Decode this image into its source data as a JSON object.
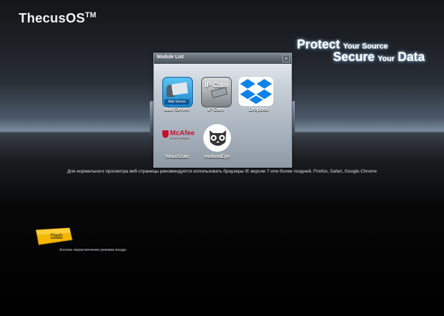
{
  "brand": {
    "name": "ThecusOS",
    "tm": "TM"
  },
  "tagline": {
    "line1_big": "Protect",
    "line1_small": "Your Source",
    "line2_big1": "Secure",
    "line2_small": "Your",
    "line2_big2": "Data"
  },
  "module_list": {
    "title": "Module List",
    "close_symbol": "×",
    "modules": [
      {
        "label": "Mail Server",
        "icon": "mail-server-icon",
        "icon_text": "Mail Server"
      },
      {
        "label": "IP Cam",
        "icon": "ip-cam-icon",
        "icon_text": "IP Cam"
      },
      {
        "label": "Dropbox",
        "icon": "dropbox-icon"
      },
      {
        "label": "VirusScan",
        "icon": "mcafee-icon",
        "icon_text": "McAfee",
        "icon_subtext": "An Intel Company"
      },
      {
        "label": "motionEye",
        "icon": "owl-icon"
      }
    ]
  },
  "notice": "Для нормального просмотра веб-страницы рекомендуется использовать браузеры IE версии 7 или более поздней, Firefox, Safari, Google Chrome",
  "flash": {
    "button_label": "Flash",
    "note": "Кнопка переключения режима входа."
  },
  "colors": {
    "dropbox_blue": "#0d82e8",
    "mcafee_red": "#c8102e",
    "flash_yellow": "#f5b800",
    "mail_blue": "#1a86d2"
  }
}
